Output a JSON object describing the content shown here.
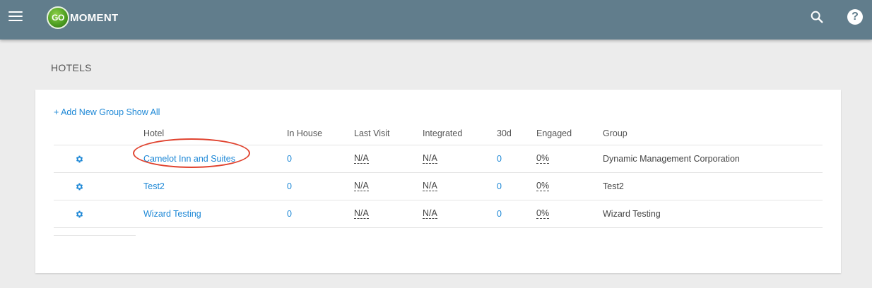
{
  "header": {
    "menu_icon": "hamburger-menu-icon",
    "logo": {
      "badge": "GO",
      "text": "MOMENT"
    },
    "search_icon": "search-icon",
    "help_icon": "help-icon",
    "help_glyph": "?",
    "bar_color": "#617d8c"
  },
  "page": {
    "title": "HOTELS"
  },
  "actions": {
    "add_group_label": "+ Add New Group",
    "show_all_label": "Show All"
  },
  "table": {
    "columns": [
      "Hotel",
      "In House",
      "Last Visit",
      "Integrated",
      "30d",
      "Engaged",
      "Group"
    ],
    "rows": [
      {
        "hotel": "Camelot Inn and Suites",
        "in_house": "0",
        "last_visit": "N/A",
        "integrated": "N/A",
        "d30": "0",
        "engaged": "0%",
        "group": "Dynamic Management Corporation",
        "highlighted": true
      },
      {
        "hotel": "Test2",
        "in_house": "0",
        "last_visit": "N/A",
        "integrated": "N/A",
        "d30": "0",
        "engaged": "0%",
        "group": "Test2",
        "highlighted": false
      },
      {
        "hotel": "Wizard Testing",
        "in_house": "0",
        "last_visit": "N/A",
        "integrated": "N/A",
        "d30": "0",
        "engaged": "0%",
        "group": "Wizard Testing",
        "highlighted": false
      }
    ]
  },
  "colors": {
    "link": "#1e88d6",
    "annotation": "#e0432f",
    "background": "#ececec"
  }
}
